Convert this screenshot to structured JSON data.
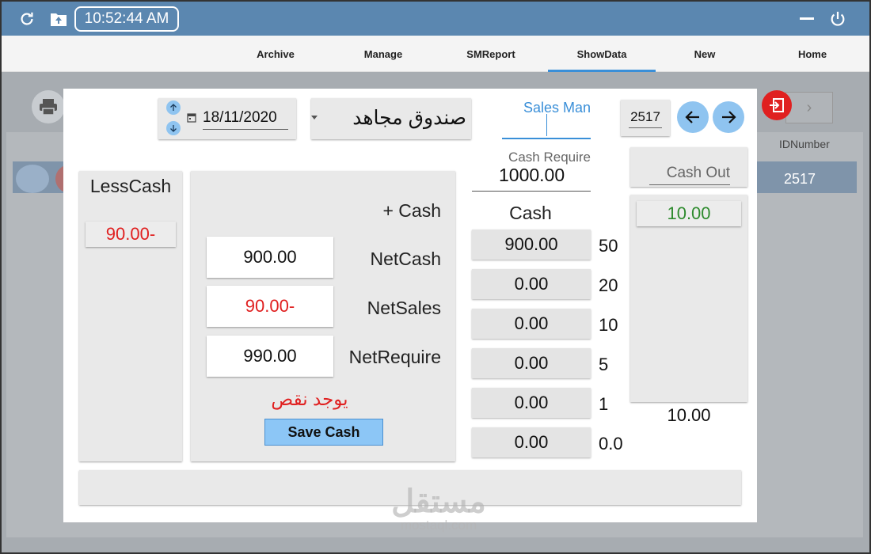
{
  "titlebar": {
    "clock": "10:52:44 AM",
    "icons": [
      "refresh-icon",
      "cloud-upload-icon",
      "minimize-icon",
      "power-icon"
    ]
  },
  "menu": {
    "items": [
      "Archive",
      "Manage",
      "SMReport",
      "ShowData",
      "New",
      "Home"
    ],
    "active": "ShowData"
  },
  "background": {
    "column_header": "IDNumber",
    "row_value": "2517"
  },
  "dialog": {
    "date": "18/11/2020",
    "box_name": "صندوق مجاهد",
    "sales_man_label": "Sales Man",
    "id_value": "2517",
    "cash_require_label": "Cash Require",
    "cash_require_value": "1000.00",
    "cash_out_label": "Cash Out",
    "cash_out_value": "10.00",
    "cash_out_total": "10.00",
    "less_cash_label": "LessCash",
    "less_cash_value": "90.00-",
    "plus_cash_label": "+ Cash",
    "net_cash_label": "NetCash",
    "net_cash_value": "900.00",
    "net_sales_label": "NetSales",
    "net_sales_value": "90.00-",
    "net_require_label": "NetRequire",
    "net_require_value": "990.00",
    "warning": "يوجد نقص",
    "save_button": "Save Cash",
    "cash_header": "Cash",
    "cash_rows": [
      {
        "amount": "900.00",
        "denom": "50"
      },
      {
        "amount": "0.00",
        "denom": "20"
      },
      {
        "amount": "0.00",
        "denom": "10"
      },
      {
        "amount": "0.00",
        "denom": "5"
      },
      {
        "amount": "0.00",
        "denom": "1"
      },
      {
        "amount": "0.00",
        "denom": "0.0"
      }
    ]
  },
  "watermark": {
    "main": "مستقل",
    "sub": "mostaql.com"
  },
  "colors": {
    "accent": "#3a8fd8",
    "titlebar": "#5b87b0",
    "negative": "#e02020",
    "positive": "#2e8b2e",
    "exit": "#e02020"
  }
}
